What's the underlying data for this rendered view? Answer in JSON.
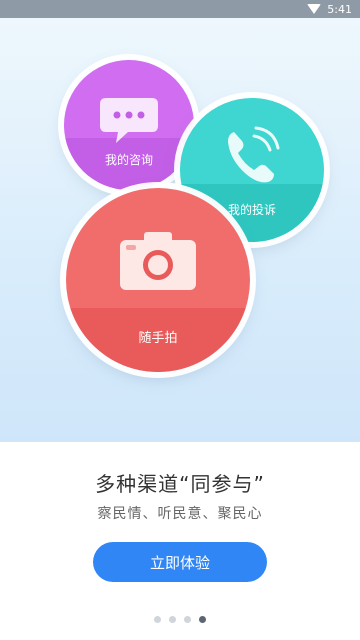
{
  "status_bar": {
    "time": "5:41",
    "wifi_icon": "wifi-icon"
  },
  "hero": {
    "consult": {
      "label": "我的咨询",
      "icon": "chat-bubble-icon",
      "color": "#d16df0"
    },
    "complaint": {
      "label": "我的投诉",
      "icon": "phone-icon",
      "color": "#3fd5d0"
    },
    "photo": {
      "label": "随手拍",
      "icon": "camera-icon",
      "color": "#f06d6b"
    }
  },
  "headline": "多种渠道“同参与”",
  "subline": "察民情、听民意、聚民心",
  "cta_label": "立即体验",
  "accent_color": "#2f86f4",
  "pager": {
    "total": 4,
    "active_index": 3
  }
}
